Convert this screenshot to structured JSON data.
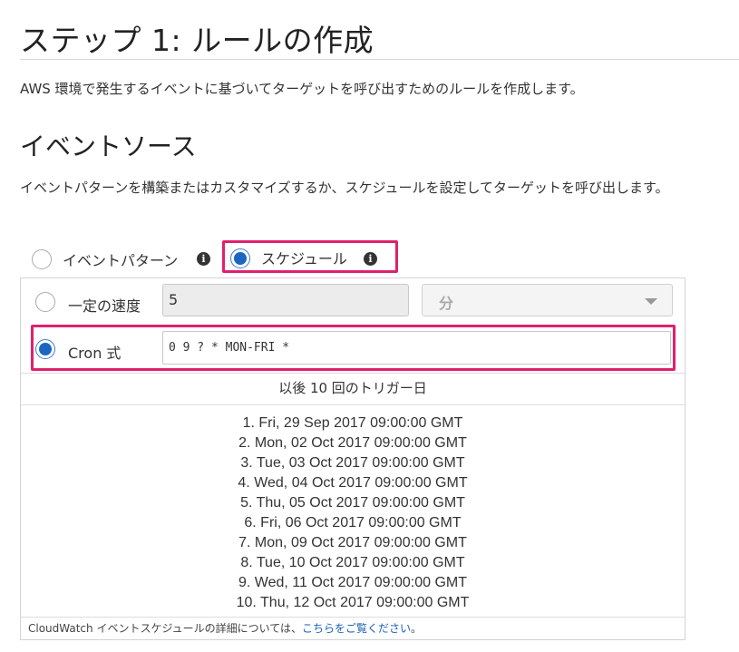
{
  "page": {
    "title": "ステップ 1: ルールの作成",
    "intro": "AWS 環境で発生するイベントに基づいてターゲットを呼び出すためのルールを作成します。"
  },
  "event_source": {
    "heading": "イベントソース",
    "description": "イベントパターンを構築またはカスタマイズするか、スケジュールを設定してターゲットを呼び出します。",
    "options": [
      {
        "label": "イベントパターン",
        "selected": false,
        "info_icon": "info-icon"
      },
      {
        "label": "スケジュール",
        "selected": true,
        "info_icon": "info-icon"
      }
    ]
  },
  "schedule": {
    "fixed_rate": {
      "label": "一定の速度",
      "selected": false,
      "value": "5",
      "unit": "分"
    },
    "cron": {
      "label": "Cron 式",
      "selected": true,
      "value": "0 9 ? * MON-FRI *"
    },
    "triggers_header": "以後 10 回のトリガー日",
    "triggers": [
      "1. Fri, 29 Sep 2017 09:00:00 GMT",
      "2. Mon, 02 Oct 2017 09:00:00 GMT",
      "3. Tue, 03 Oct 2017 09:00:00 GMT",
      "4. Wed, 04 Oct 2017 09:00:00 GMT",
      "5. Thu, 05 Oct 2017 09:00:00 GMT",
      "6. Fri, 06 Oct 2017 09:00:00 GMT",
      "7. Mon, 09 Oct 2017 09:00:00 GMT",
      "8. Tue, 10 Oct 2017 09:00:00 GMT",
      "9. Wed, 11 Oct 2017 09:00:00 GMT",
      "10. Thu, 12 Oct 2017 09:00:00 GMT"
    ],
    "footer_text": "CloudWatch イベントスケジュールの詳細については、",
    "footer_link": "こちらをご覧ください",
    "footer_end": "。"
  },
  "colors": {
    "highlight": "#e0206d",
    "radio_selected": "#1a66c2",
    "link": "#1a5fb4"
  }
}
